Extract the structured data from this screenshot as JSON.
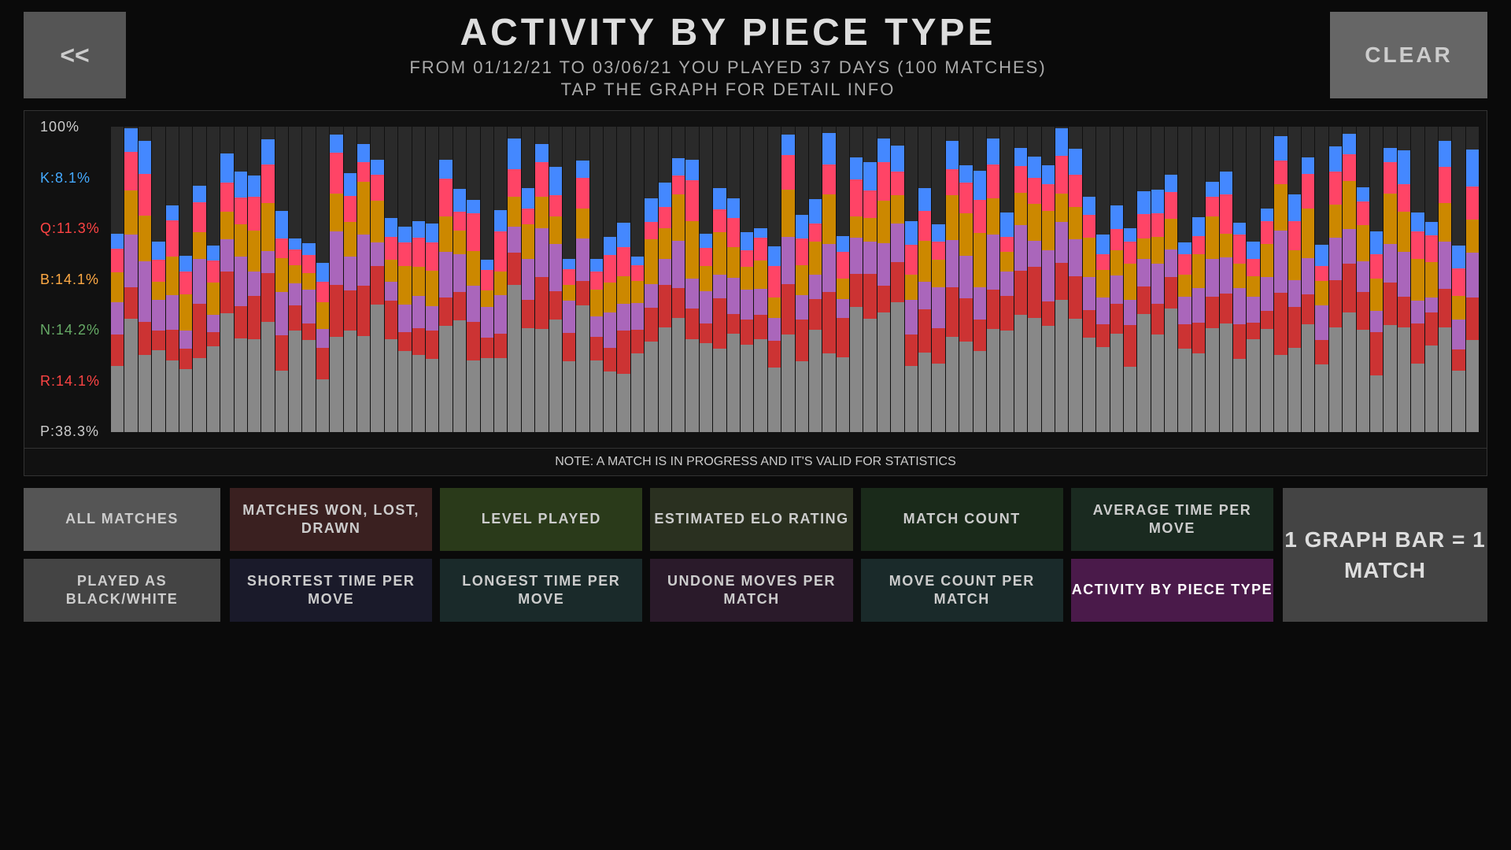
{
  "header": {
    "back_label": "<<",
    "title": "ACTIVITY BY PIECE TYPE",
    "subtitle": "FROM 01/12/21 TO 03/06/21 YOU PLAYED 37 DAYS (100 MATCHES)",
    "tap_hint": "TAP THE GRAPH FOR DETAIL INFO",
    "clear_label": "CLEAR"
  },
  "chart": {
    "y_labels": {
      "top": "100%",
      "k": "K:8.1%",
      "q": "Q:11.3%",
      "b": "B:14.1%",
      "n": "N:14.2%",
      "r": "R:14.1%",
      "p": "P:38.3%"
    },
    "note": "NOTE: A MATCH IS IN PROGRESS AND IT'S VALID FOR STATISTICS",
    "colors": {
      "K": "#4488ff",
      "Q": "#ff4466",
      "B": "#ffaa00",
      "N": "#66aa22",
      "R": "#ff4466",
      "P": "#888888",
      "empty": "#444444"
    }
  },
  "buttons": {
    "all_matches": "ALL\nMATCHES",
    "played_as": "PLAYED AS\nBLACK/WHITE",
    "matches_won": "MATCHES WON,\nLOST, DRAWN",
    "level_played": "LEVEL\nPLAYED",
    "elo_rating": "ESTIMATED\nELO RATING",
    "match_count": "MATCH\nCOUNT",
    "avg_time": "AVERAGE TIME\nPER MOVE",
    "shortest": "SHORTEST TIME\nPER MOVE",
    "longest": "LONGEST TIME\nPER MOVE",
    "undone": "UNDONE MOVES\nPER MATCH",
    "move_count": "MOVE COUNT\nPER MATCH",
    "activity": "ACTIVITY BY\nPIECE TYPE",
    "graph_bar": "1 GRAPH BAR\n=\n1 MATCH"
  }
}
